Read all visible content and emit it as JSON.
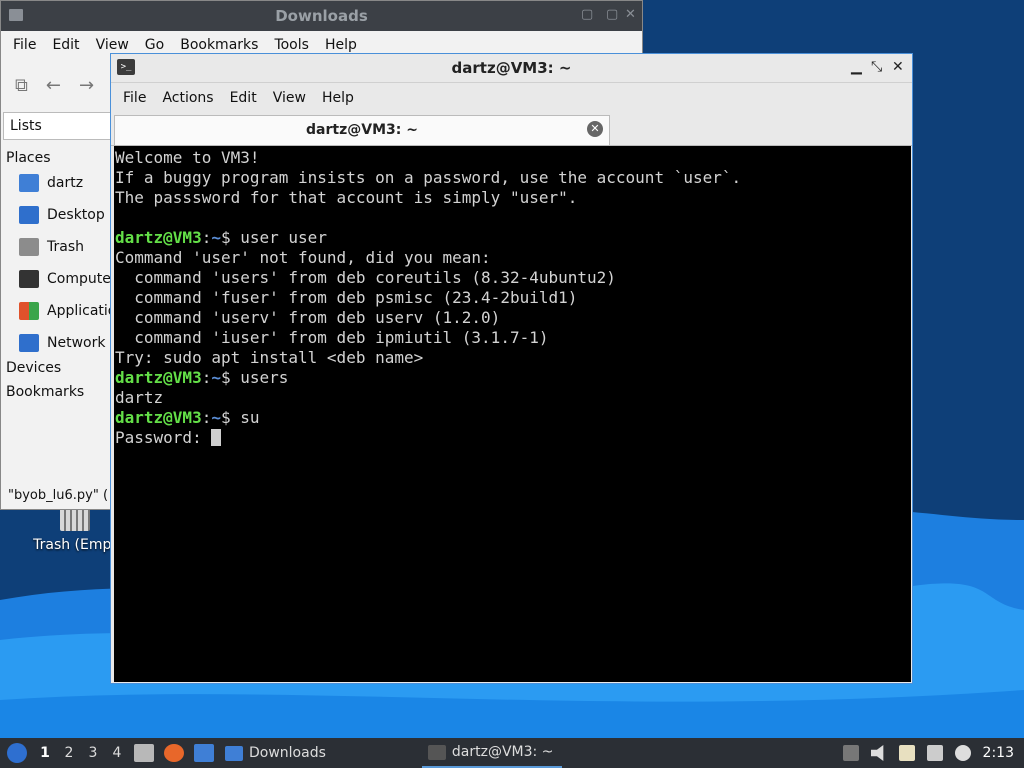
{
  "desktop": {
    "trash_label": "Trash (Empt"
  },
  "file_manager": {
    "title": "Downloads",
    "menu": [
      "File",
      "Edit",
      "View",
      "Go",
      "Bookmarks",
      "Tools",
      "Help"
    ],
    "sidebar_header": "Lists",
    "places_label": "Places",
    "places": [
      {
        "label": "dartz",
        "icon": "home-folder-icon",
        "color": "#3f7fd6"
      },
      {
        "label": "Desktop",
        "icon": "desktop-icon",
        "color": "#2f6fcc"
      },
      {
        "label": "Trash",
        "icon": "trash-icon",
        "color": "#8c8c8c"
      },
      {
        "label": "Compute",
        "icon": "computer-icon",
        "color": "#333333"
      },
      {
        "label": "Applicatio",
        "icon": "applications-icon",
        "color": "#e0522b"
      },
      {
        "label": "Network",
        "icon": "network-icon",
        "color": "#2f6fcc"
      }
    ],
    "devices_label": "Devices",
    "bookmarks_label": "Bookmarks",
    "status_text": "\"byob_lu6.py\" ("
  },
  "terminal": {
    "title": "dartz@VM3: ~",
    "menu": [
      "File",
      "Actions",
      "Edit",
      "View",
      "Help"
    ],
    "tab_label": "dartz@VM3: ~",
    "motd": [
      "Welcome to VM3!",
      "If a buggy program insists on a password, use the account `user`.",
      "The passsword for that account is simply \"user\"."
    ],
    "prompt_user": "dartz@VM3",
    "prompt_dir": "~",
    "cmd1": "user user",
    "cmd1_output": [
      "Command 'user' not found, did you mean:",
      "  command 'users' from deb coreutils (8.32-4ubuntu2)",
      "  command 'fuser' from deb psmisc (23.4-2build1)",
      "  command 'userv' from deb userv (1.2.0)",
      "  command 'iuser' from deb ipmiutil (3.1.7-1)",
      "Try: sudo apt install <deb name>"
    ],
    "cmd2": "users",
    "cmd2_output": "dartz",
    "cmd3": "su",
    "password_prompt": "Password: "
  },
  "taskbar": {
    "workspaces": [
      "1",
      "2",
      "3",
      "4"
    ],
    "active_workspace": "1",
    "tasks": [
      {
        "label": "Downloads",
        "icon": "folder-icon",
        "color": "#3f7fd6"
      },
      {
        "label": "dartz@VM3: ~",
        "icon": "terminal-icon",
        "color": "#555555"
      }
    ],
    "clock": "2:13"
  },
  "colors": {
    "accent": "#4a90d9",
    "prompt_user": "#64e048",
    "prompt_dir": "#5c8fd8",
    "terminal_bg": "#000000"
  }
}
